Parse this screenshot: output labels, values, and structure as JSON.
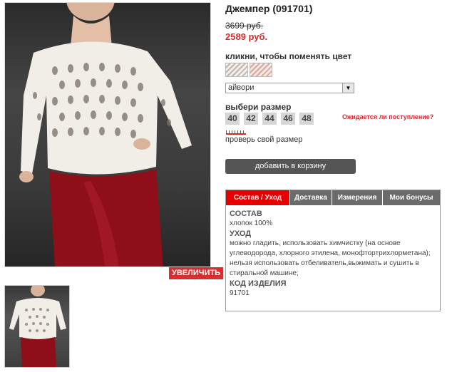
{
  "product": {
    "title": "Джемпер (091701)",
    "price_old": "3699 руб.",
    "price_new": "2589 руб.",
    "zoom_label": "УВЕЛИЧИТЬ"
  },
  "color": {
    "label": "кликни, чтобы поменять цвет",
    "selected": "айвори",
    "swatches": [
      "ivory-swatch",
      "pink-swatch"
    ]
  },
  "size": {
    "label": "выбери размер",
    "options": [
      "40",
      "42",
      "44",
      "46",
      "48"
    ],
    "notify_text": "Ожидается ли поступление?",
    "check_label": "проверь свой размер"
  },
  "cart": {
    "button_label": "добавить в корзину"
  },
  "tabs": {
    "items": [
      "Состав / Уход",
      "Доставка",
      "Измерения",
      "Мои бонусы"
    ],
    "active": "Состав / Уход",
    "content": {
      "composition_heading": "СОСТАВ",
      "composition_text": "хлопок 100%",
      "care_heading": "УХОД",
      "care_text": "можно гладить, использовать химчистку (на основе углеводорода, хлорного этилена, монофтортрихлорметана); нельзя использовать отбеливатель,выжимать и сушить в стиральной машине;",
      "code_heading": "КОД ИЗДЕЛИЯ",
      "code_value": "91701"
    }
  },
  "colors": {
    "accent": "#d92a2a",
    "tab_active": "#e60000",
    "tab_inactive": "#6b6b6b",
    "button_dark": "#555555"
  }
}
